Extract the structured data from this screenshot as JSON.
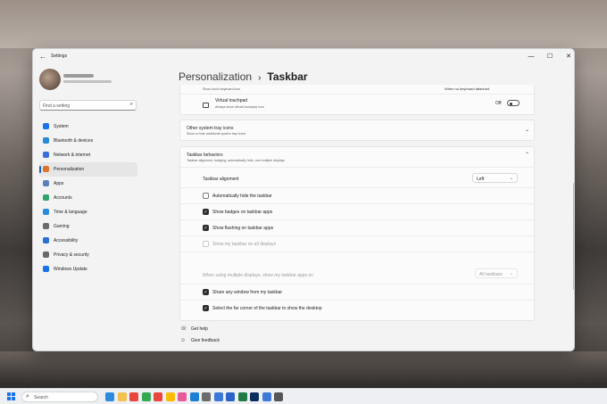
{
  "window": {
    "title": "Settings",
    "back": "←",
    "minimize": "—",
    "maximize": "☐",
    "close": "✕"
  },
  "search": {
    "placeholder": "Find a setting",
    "icon": "search-icon"
  },
  "nav": [
    {
      "label": "System",
      "icon": "monitor-icon",
      "color": "#1a73e8"
    },
    {
      "label": "Bluetooth & devices",
      "icon": "bluetooth-icon",
      "color": "#2a8ad4"
    },
    {
      "label": "Network & internet",
      "icon": "wifi-icon",
      "color": "#3a6fd8"
    },
    {
      "label": "Personalization",
      "icon": "brush-icon",
      "color": "#d9752b",
      "selected": true
    },
    {
      "label": "Apps",
      "icon": "apps-icon",
      "color": "#5a7fbf"
    },
    {
      "label": "Accounts",
      "icon": "person-icon",
      "color": "#2fa36b"
    },
    {
      "label": "Time & language",
      "icon": "globe-clock-icon",
      "color": "#2c8ad6"
    },
    {
      "label": "Gaming",
      "icon": "controller-icon",
      "color": "#6b6b6b"
    },
    {
      "label": "Accessibility",
      "icon": "accessibility-icon",
      "color": "#2a6fd1"
    },
    {
      "label": "Privacy & security",
      "icon": "shield-icon",
      "color": "#6a6a6a"
    },
    {
      "label": "Windows Update",
      "icon": "update-icon",
      "color": "#1a73e8"
    }
  ],
  "breadcrumb": {
    "parent": "Personalization",
    "separator": "›",
    "current": "Taskbar"
  },
  "touch_keyboard": {
    "subtitle": "Show touch keyboard icon",
    "value": "When no keyboard attached"
  },
  "virtual_touchpad": {
    "title": "Virtual touchpad",
    "subtitle": "Always show virtual touchpad icon",
    "state": "Off"
  },
  "other_tray": {
    "title": "Other system tray icons",
    "subtitle": "Show or hide additional system tray icons",
    "chevron": "⌄"
  },
  "behaviors": {
    "title": "Taskbar behaviors",
    "subtitle": "Taskbar alignment, badging, automatically hide, and multiple displays",
    "chevron": "⌃",
    "alignment_label": "Taskbar alignment",
    "alignment_value": "Left",
    "items": [
      {
        "label": "Automatically hide the taskbar",
        "checked": false
      },
      {
        "label": "Show badges on taskbar apps",
        "checked": true
      },
      {
        "label": "Show flashing on taskbar apps",
        "checked": true
      },
      {
        "label": "Show my taskbar on all displays",
        "checked": false,
        "disabled": true
      }
    ],
    "multi_label": "When using multiple displays, show my taskbar apps on",
    "multi_value": "All taskbars",
    "items2": [
      {
        "label": "Share any window from my taskbar",
        "checked": true
      },
      {
        "label": "Select the far corner of the taskbar to show the desktop",
        "checked": true
      }
    ]
  },
  "help": {
    "get_help": "Get help",
    "give_feedback": "Give feedback"
  },
  "taskbar": {
    "search_label": "Search",
    "apps": [
      "edge",
      "file-explorer",
      "chrome",
      "chrome",
      "chrome",
      "chrome",
      "paint",
      "edge-dev",
      "settings",
      "store",
      "phone-link",
      "excel",
      "photoshop",
      "notepad",
      "settings-gear"
    ]
  }
}
